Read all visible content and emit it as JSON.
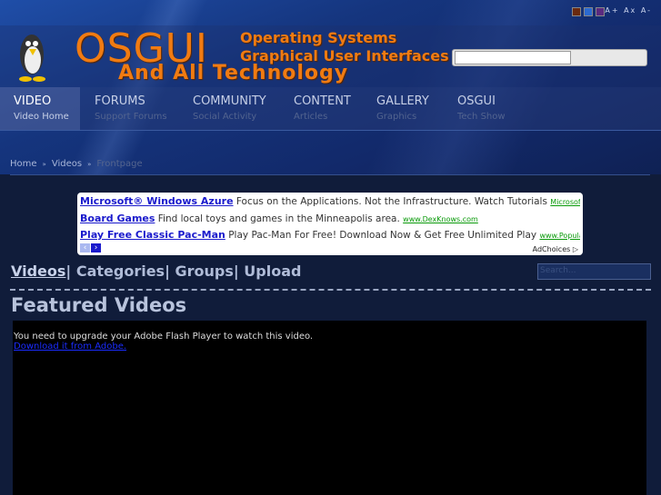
{
  "header": {
    "logo_main": "OSGUI",
    "logo_sub1": "Operating Systems",
    "logo_sub2": "Graphical User Interfaces",
    "logo_tagline": "And All Technology",
    "font_controls": "A+ Ax A-",
    "search_value": ""
  },
  "nav": [
    {
      "title": "VIDEO",
      "sub": "Video Home",
      "active": true
    },
    {
      "title": "FORUMS",
      "sub": "Support Forums"
    },
    {
      "title": "COMMUNITY",
      "sub": "Social Activity"
    },
    {
      "title": "CONTENT",
      "sub": "Articles"
    },
    {
      "title": "GALLERY",
      "sub": "Graphics"
    },
    {
      "title": "OSGUI",
      "sub": "Tech Show"
    }
  ],
  "breadcrumb": {
    "home": "Home",
    "videos": "Videos",
    "current": "Frontpage",
    "sep": "»"
  },
  "ads": [
    {
      "title": "Microsoft® Windows Azure",
      "text": "Focus on the Applications. Not the Infrastructure. Watch Tutorials",
      "url": "Microsoft.com/Cloud"
    },
    {
      "title": "Board Games",
      "text": "Find local toys and games in the Minneapolis area.",
      "url": "www.DexKnows.com"
    },
    {
      "title": "Play Free Classic Pac-Man",
      "text": "Play Pac-Man For Free! Download Now & Get Free Unlimited Play",
      "url": "www.PopularDownloads"
    }
  ],
  "ad_choices": "AdChoices ▷",
  "video_nav": {
    "videos": "Videos",
    "categories": "Categories",
    "groups": "Groups",
    "upload": "Upload",
    "sep": "|"
  },
  "video_search_placeholder": "Search...",
  "featured_title": "Featured Videos",
  "player": {
    "message": "You need to upgrade your Adobe Flash Player to watch this video.",
    "link": "Download it from Adobe."
  }
}
